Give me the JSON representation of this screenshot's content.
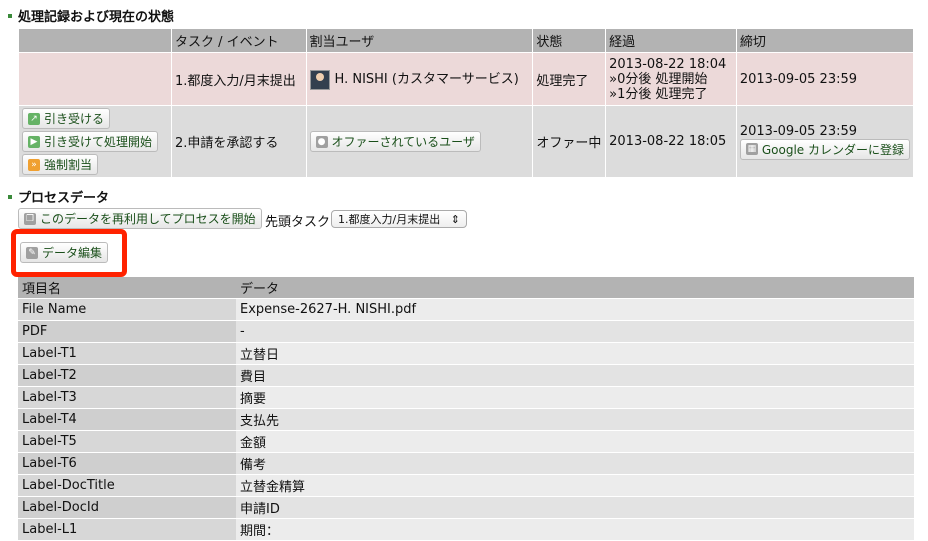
{
  "history": {
    "title": "処理記録および現在の状態",
    "headers": [
      "タスク / イベント",
      "割当ユーザ",
      "状態",
      "経過",
      "締切"
    ],
    "row1": {
      "task": "1.都度入力/月末提出",
      "user": "H. NISHI (カスタマーサービス)",
      "status": "処理完了",
      "elapsed_main": "2013-08-22 18:04",
      "elapsed_sub1": "»0分後 処理開始",
      "elapsed_sub2": "»1分後 処理完了",
      "deadline": "2013-09-05 23:59"
    },
    "row2": {
      "btn_accept": "引き受ける",
      "btn_accept_start": "引き受けて処理開始",
      "btn_force": "強制割当",
      "task": "2.申請を承認する",
      "user_button": "オファーされているユーザ",
      "status": "オファー中",
      "elapsed_main": "2013-08-22 18:05",
      "deadline": "2013-09-05 23:59",
      "calendar_button": "Google カレンダーに登録"
    }
  },
  "process": {
    "title": "プロセスデータ",
    "reuse_button": "このデータを再利用してプロセスを開始",
    "first_task_label": "先頭タスク",
    "first_task_select": "1.都度入力/月末提出",
    "edit_button": "データ編集",
    "headers": [
      "項目名",
      "データ"
    ],
    "rows": [
      {
        "key": "File Name",
        "value": "Expense-2627-H. NISHI.pdf"
      },
      {
        "key": "PDF",
        "value": "-"
      },
      {
        "key": "Label-T1",
        "value": "立替日"
      },
      {
        "key": "Label-T2",
        "value": "費目"
      },
      {
        "key": "Label-T3",
        "value": "摘要"
      },
      {
        "key": "Label-T4",
        "value": "支払先"
      },
      {
        "key": "Label-T5",
        "value": "金額"
      },
      {
        "key": "Label-T6",
        "value": "備考"
      },
      {
        "key": "Label-DocTitle",
        "value": "立替金精算"
      },
      {
        "key": "Label-DocId",
        "value": "申請ID"
      },
      {
        "key": "Label-L1",
        "value": "期間："
      }
    ]
  }
}
